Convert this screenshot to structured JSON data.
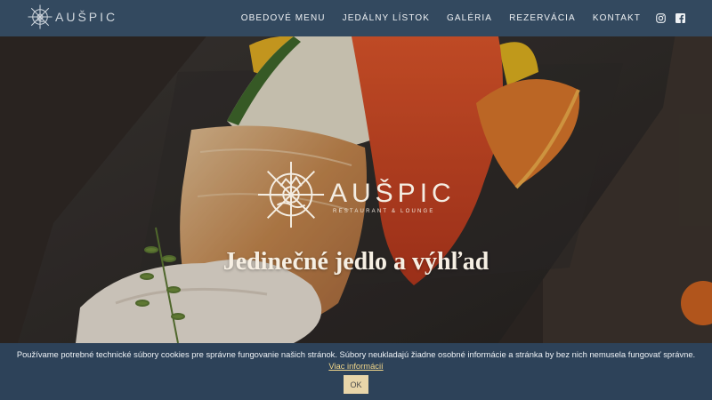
{
  "header": {
    "logo_text": "AUŠPIC",
    "menu": [
      "OBEDOVÉ MENU",
      "JEDÁLNY LÍSTOK",
      "GALÉRIA",
      "REZERVÁCIA",
      "KONTAKT"
    ],
    "social": [
      "instagram-icon",
      "facebook-icon"
    ]
  },
  "hero": {
    "logo_name": "AUŠPIC",
    "logo_subtitle": "RESTAURANT & LOUNGE",
    "headline": "Jedinečné jedlo a výhľad"
  },
  "cookie": {
    "text": "Používame potrebné technické súbory cookies pre správne fungovanie našich stránok. Súbory neukladajú žiadne osobné informácie a stránka by bez nich nemusela fungovať správne.",
    "link": "Viac informácií",
    "ok_label": "OK"
  },
  "colors": {
    "nav_bg": "#33495f",
    "cookie_bg": "#2d4259",
    "accent": "#e8d5a9",
    "link": "#f2d78a"
  }
}
